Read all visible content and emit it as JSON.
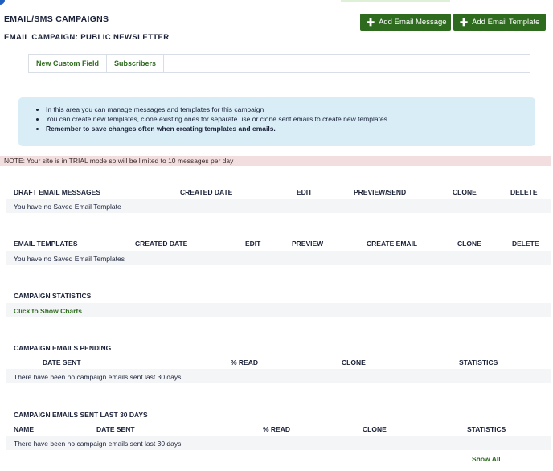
{
  "header": {
    "title": "EMAIL/SMS CAMPAIGNS",
    "subtitle": "EMAIL CAMPAIGN: PUBLIC NEWSLETTER",
    "add_email_message": "Add Email Message",
    "add_email_template": "Add Email Template"
  },
  "tabs": [
    "New Custom Field",
    "Subscribers"
  ],
  "info": {
    "items": [
      "In this area you can manage messages and templates for this campaign",
      "You can create new templates, clone existing ones for separate use or clone sent emails to create new templates",
      "Remember to save changes often when creating templates and emails."
    ]
  },
  "trial_notice": "NOTE: Your site is in TRIAL mode so will be limited to 10 messages per day",
  "draft": {
    "columns": [
      "DRAFT EMAIL MESSAGES",
      "CREATED DATE",
      "EDIT",
      "PREVIEW/SEND",
      "CLONE",
      "DELETE"
    ],
    "empty": "You have no Saved Email Template"
  },
  "templates": {
    "columns": [
      "EMAIL TEMPLATES",
      "CREATED DATE",
      "EDIT",
      "PREVIEW",
      "CREATE EMAIL",
      "CLONE",
      "DELETE"
    ],
    "empty": "You have no Saved Email Templates"
  },
  "stats": {
    "title": "CAMPAIGN STATISTICS",
    "link": "Click to Show Charts"
  },
  "pending": {
    "title": "CAMPAIGN EMAILS PENDING",
    "columns": [
      "DATE SENT",
      "% READ",
      "CLONE",
      "STATISTICS"
    ],
    "empty": "There have been no campaign emails sent last 30 days"
  },
  "sent": {
    "title": "CAMPAIGN EMAILS SENT LAST 30 DAYS",
    "columns": [
      "NAME",
      "DATE SENT",
      "% READ",
      "CLONE",
      "STATISTICS"
    ],
    "empty": "There have been no campaign emails sent last 30 days",
    "show_all": "Show All"
  }
}
